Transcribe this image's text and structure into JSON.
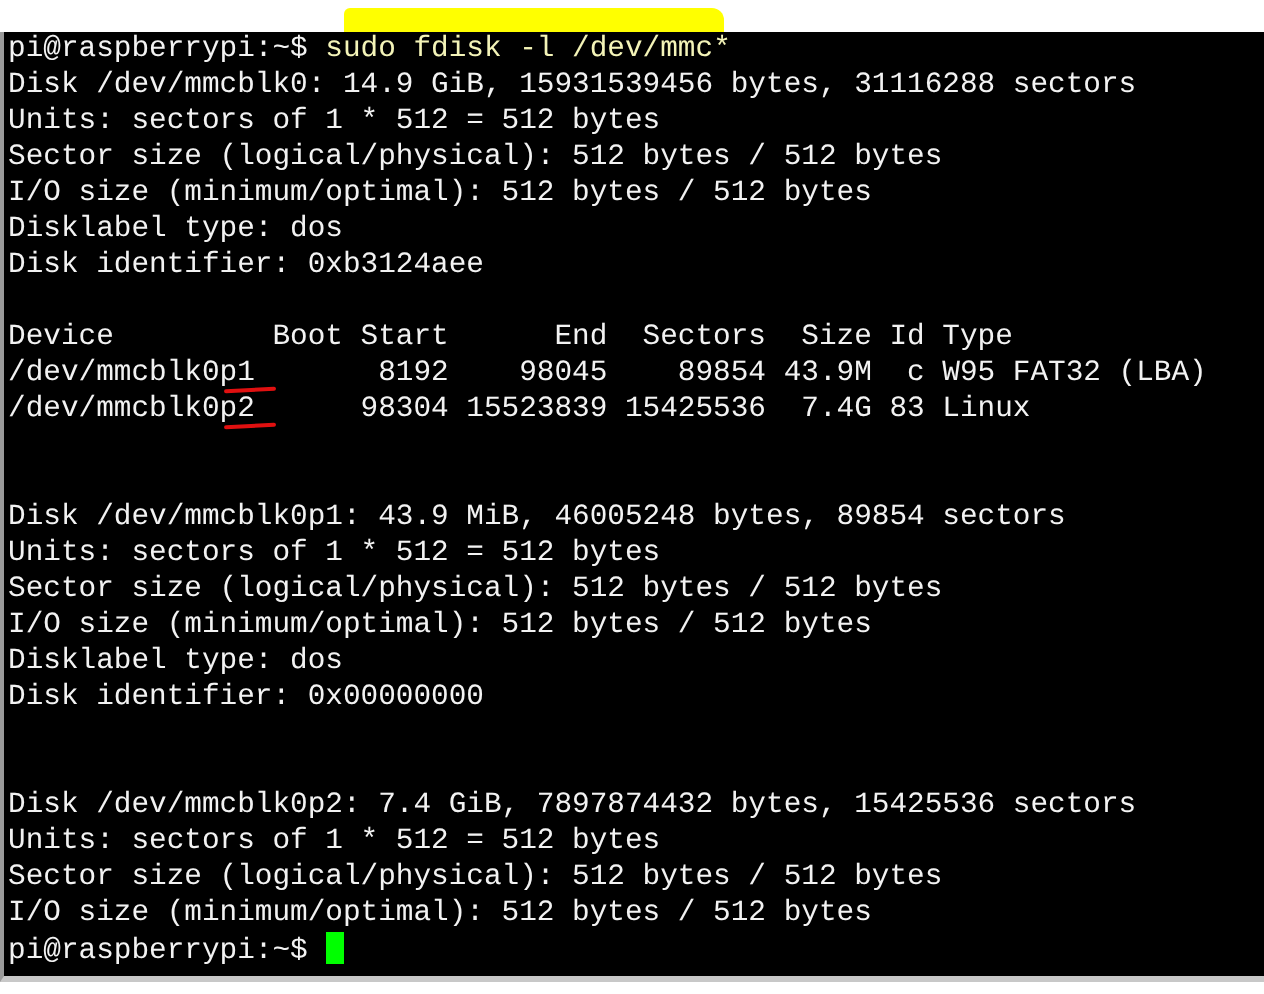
{
  "terminal": {
    "lines": [
      {
        "kind": "command",
        "prompt": "pi@raspberrypi:~$ ",
        "command": "sudo fdisk -l /dev/mmc*"
      },
      {
        "kind": "output",
        "text": "Disk /dev/mmcblk0: 14.9 GiB, 15931539456 bytes, 31116288 sectors"
      },
      {
        "kind": "output",
        "text": "Units: sectors of 1 * 512 = 512 bytes"
      },
      {
        "kind": "output",
        "text": "Sector size (logical/physical): 512 bytes / 512 bytes"
      },
      {
        "kind": "output",
        "text": "I/O size (minimum/optimal): 512 bytes / 512 bytes"
      },
      {
        "kind": "output",
        "text": "Disklabel type: dos"
      },
      {
        "kind": "output",
        "text": "Disk identifier: 0xb3124aee"
      },
      {
        "kind": "blank"
      },
      {
        "kind": "output",
        "text": "Device         Boot Start      End  Sectors  Size Id Type"
      },
      {
        "kind": "output",
        "text": "/dev/mmcblk0p1       8192    98045    89854 43.9M  c W95 FAT32 (LBA)",
        "underlined": true
      },
      {
        "kind": "output",
        "text": "/dev/mmcblk0p2      98304 15523839 15425536  7.4G 83 Linux",
        "underlined": true
      },
      {
        "kind": "blank"
      },
      {
        "kind": "blank"
      },
      {
        "kind": "output",
        "text": "Disk /dev/mmcblk0p1: 43.9 MiB, 46005248 bytes, 89854 sectors"
      },
      {
        "kind": "output",
        "text": "Units: sectors of 1 * 512 = 512 bytes"
      },
      {
        "kind": "output",
        "text": "Sector size (logical/physical): 512 bytes / 512 bytes"
      },
      {
        "kind": "output",
        "text": "I/O size (minimum/optimal): 512 bytes / 512 bytes"
      },
      {
        "kind": "output",
        "text": "Disklabel type: dos"
      },
      {
        "kind": "output",
        "text": "Disk identifier: 0x00000000"
      },
      {
        "kind": "blank"
      },
      {
        "kind": "blank"
      },
      {
        "kind": "output",
        "text": "Disk /dev/mmcblk0p2: 7.4 GiB, 7897874432 bytes, 15425536 sectors"
      },
      {
        "kind": "output",
        "text": "Units: sectors of 1 * 512 = 512 bytes"
      },
      {
        "kind": "output",
        "text": "Sector size (logical/physical): 512 bytes / 512 bytes"
      },
      {
        "kind": "output",
        "text": "I/O size (minimum/optimal): 512 bytes / 512 bytes"
      },
      {
        "kind": "prompt",
        "prompt": "pi@raspberrypi:~$ ",
        "cursor": true
      }
    ]
  }
}
